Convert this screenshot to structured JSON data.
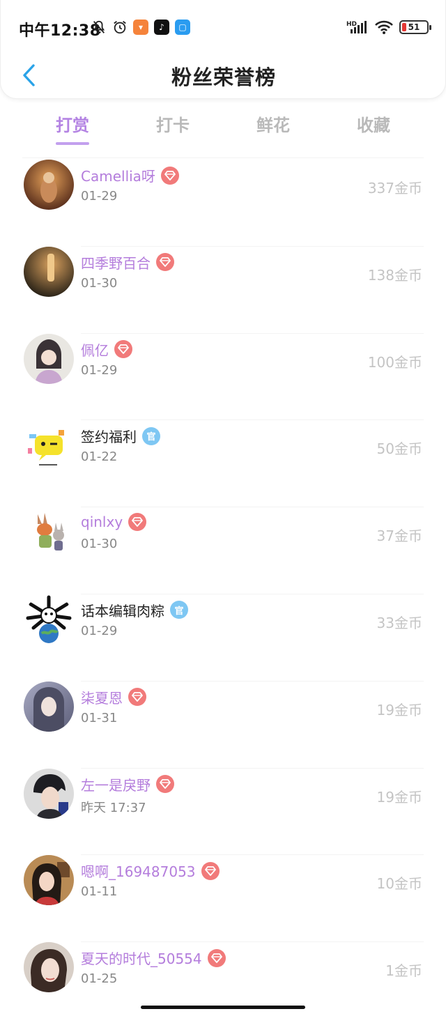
{
  "status_bar": {
    "time": "中午12:38",
    "battery": "51",
    "signal": "HD"
  },
  "header": {
    "title": "粉丝荣誉榜"
  },
  "tabs": [
    {
      "label": "打赏",
      "active": true
    },
    {
      "label": "打卡",
      "active": false
    },
    {
      "label": "鲜花",
      "active": false
    },
    {
      "label": "收藏",
      "active": false
    }
  ],
  "official_badge_text": "官",
  "list": [
    {
      "name": "Camellia呀",
      "badge": "vip",
      "date": "01-29",
      "amount": "337金币"
    },
    {
      "name": "四季野百合",
      "badge": "vip",
      "date": "01-30",
      "amount": "138金币"
    },
    {
      "name": "佩亿",
      "badge": "vip",
      "date": "01-29",
      "amount": "100金币"
    },
    {
      "name": "签约福利",
      "badge": "official",
      "date": "01-22",
      "amount": "50金币"
    },
    {
      "name": "qinlxy",
      "badge": "vip",
      "date": "01-30",
      "amount": "37金币"
    },
    {
      "name": "话本编辑肉粽",
      "badge": "official",
      "date": "01-29",
      "amount": "33金币"
    },
    {
      "name": "柒夏恩",
      "badge": "vip",
      "date": "01-31",
      "amount": "19金币"
    },
    {
      "name": "左一是戾野",
      "badge": "vip",
      "date": "昨天 17:37",
      "amount": "19金币"
    },
    {
      "name": "嗯啊_169487053",
      "badge": "vip",
      "date": "01-11",
      "amount": "10金币"
    },
    {
      "name": "夏天的时代_50554",
      "badge": "vip",
      "date": "01-25",
      "amount": "1金币"
    }
  ]
}
